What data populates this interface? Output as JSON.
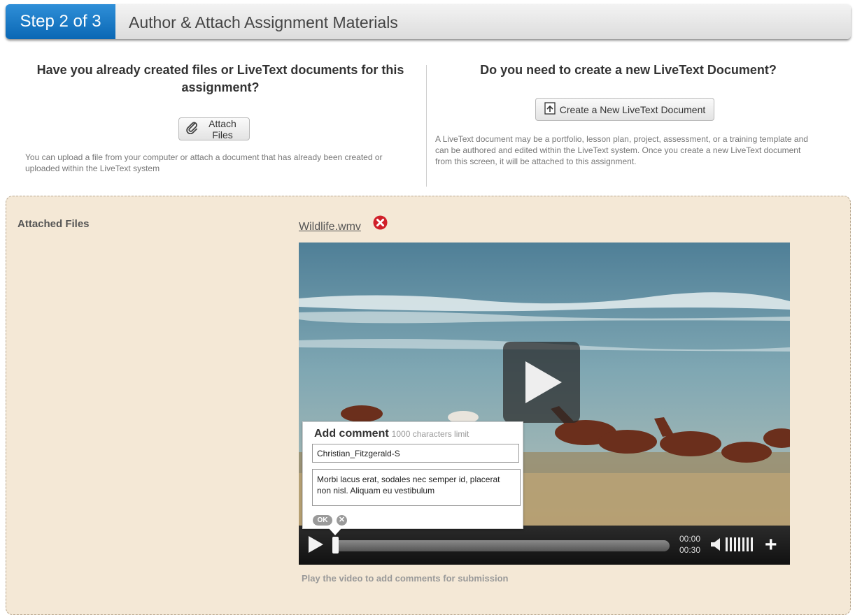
{
  "header": {
    "step": "Step 2 of 3",
    "title": "Author & Attach Assignment Materials"
  },
  "left": {
    "heading": "Have you already created files or LiveText documents for this assignment?",
    "attach_button": "Attach Files",
    "help": "You can upload a file from your computer or attach a document that has already been created or uploaded within the LiveText system"
  },
  "right": {
    "heading": "Do you need to create a new LiveText Document?",
    "create_button": "Create a New LiveText Document",
    "help": "A LiveText document may be a portfolio, lesson plan, project, assessment, or a training template and can be authored and edited within the LiveText system. Once you create a new LiveText document from this screen, it will be attached to this assignment."
  },
  "attached": {
    "label": "Attached Files",
    "file_name": "Wildlife.wmv",
    "remove_icon": "remove-red-x-icon"
  },
  "player": {
    "current_time": "00:00",
    "total_time": "00:30",
    "progress": 0,
    "hint": "Play the video to add comments for submission"
  },
  "comment": {
    "title": "Add comment",
    "limit": "1000 characters limit",
    "name": "Christian_Fitzgerald-S",
    "text": "Morbi lacus erat, sodales nec semper id, placerat non nisl. Aliquam eu vestibulum",
    "ok_label": "OK",
    "cancel_label": "✕"
  },
  "colors": {
    "accent": "#0a67b4",
    "panel_bg": "#f4e8d6",
    "remove_red": "#d0202a"
  }
}
